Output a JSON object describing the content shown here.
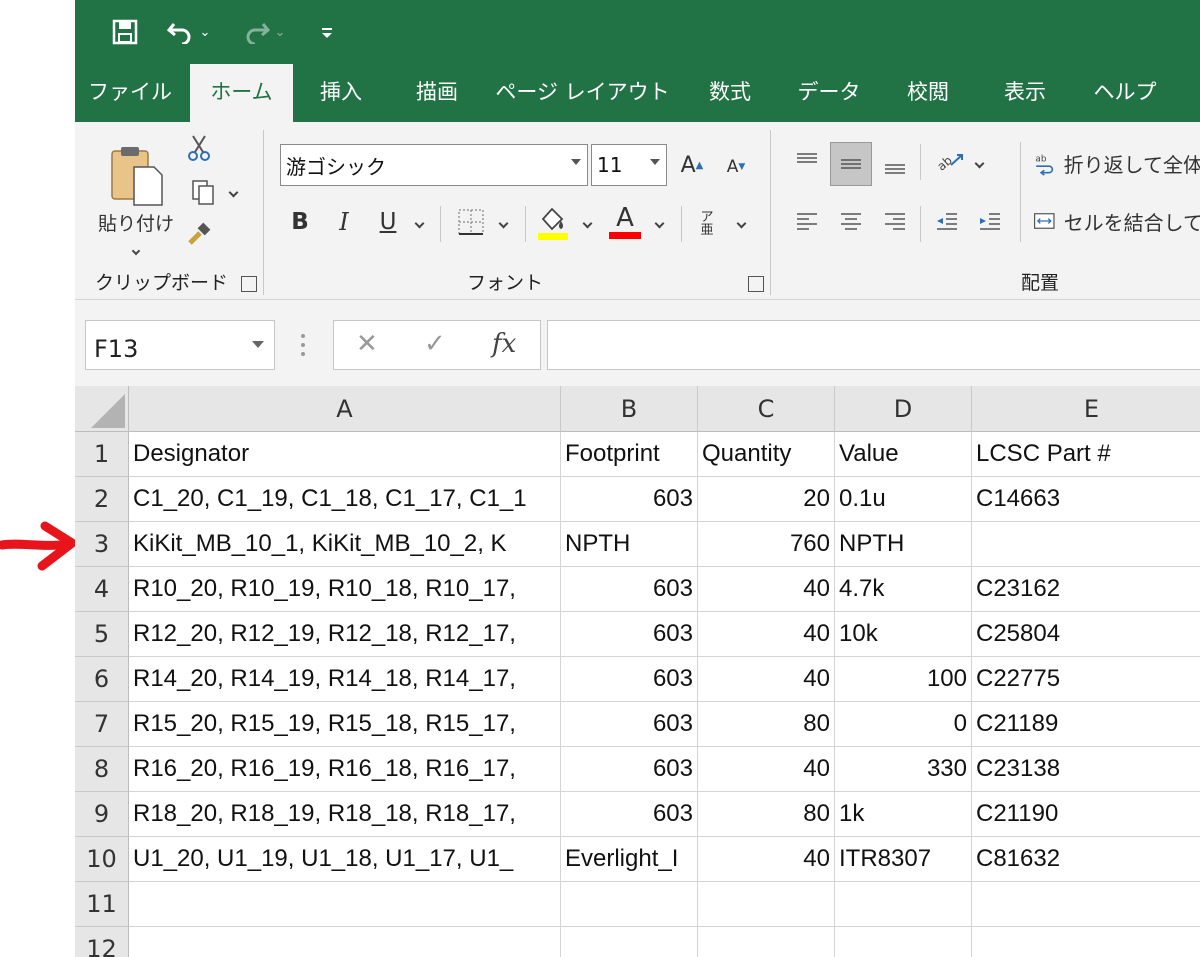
{
  "qat": {
    "save_icon": "save-icon",
    "undo_icon": "undo-icon",
    "redo_icon": "redo-icon",
    "customize_icon": "customize-qat-icon"
  },
  "tabs": [
    "ファイル",
    "ホーム",
    "挿入",
    "描画",
    "ページ レイアウト",
    "数式",
    "データ",
    "校閲",
    "表示",
    "ヘルプ"
  ],
  "active_tab": "ホーム",
  "ribbon": {
    "clipboard": {
      "paste_label": "貼り付け",
      "group_label": "クリップボード"
    },
    "font": {
      "font_name": "游ゴシック",
      "font_size": "11",
      "grow_label": "A",
      "shrink_label": "A",
      "bold": "B",
      "italic": "I",
      "underline": "U",
      "font_color_label": "A",
      "phonetic_label": "ア亜",
      "group_label": "フォント",
      "fill_color": "#ffff00",
      "font_color": "#ff0000"
    },
    "alignment": {
      "wrap_text": "折り返して全体",
      "merge_center": "セルを結合して",
      "group_label": "配置"
    }
  },
  "formula_bar": {
    "name_box": "F13",
    "cancel": "✕",
    "enter": "✓",
    "fx": "fx",
    "value": ""
  },
  "sheet": {
    "columns": [
      "A",
      "B",
      "C",
      "D",
      "E"
    ],
    "rows": [
      {
        "n": "1",
        "cells": [
          "Designator",
          "Footprint",
          "Quantity",
          "Value",
          "LCSC Part #"
        ]
      },
      {
        "n": "2",
        "cells": [
          "C1_20, C1_19, C1_18, C1_17, C1_1",
          "603",
          "20",
          "0.1u",
          "C14663"
        ]
      },
      {
        "n": "3",
        "cells": [
          "KiKit_MB_10_1, KiKit_MB_10_2, K",
          "NPTH",
          "760",
          "NPTH",
          ""
        ]
      },
      {
        "n": "4",
        "cells": [
          "R10_20, R10_19, R10_18, R10_17,",
          "603",
          "40",
          "4.7k",
          "C23162"
        ]
      },
      {
        "n": "5",
        "cells": [
          "R12_20, R12_19, R12_18, R12_17,",
          "603",
          "40",
          "10k",
          "C25804"
        ]
      },
      {
        "n": "6",
        "cells": [
          "R14_20, R14_19, R14_18, R14_17,",
          "603",
          "40",
          "100",
          "C22775"
        ]
      },
      {
        "n": "7",
        "cells": [
          "R15_20, R15_19, R15_18, R15_17,",
          "603",
          "80",
          "0",
          "C21189"
        ]
      },
      {
        "n": "8",
        "cells": [
          "R16_20, R16_19, R16_18, R16_17,",
          "603",
          "40",
          "330",
          "C23138"
        ]
      },
      {
        "n": "9",
        "cells": [
          "R18_20, R18_19, R18_18, R18_17,",
          "603",
          "80",
          "1k",
          "C21190"
        ]
      },
      {
        "n": "10",
        "cells": [
          "U1_20, U1_19, U1_18, U1_17, U1_",
          "Everlight_I",
          "40",
          "ITR8307",
          "C81632"
        ]
      },
      {
        "n": "11",
        "cells": [
          "",
          "",
          "",
          "",
          ""
        ]
      },
      {
        "n": "12",
        "cells": [
          "",
          "",
          "",
          "",
          ""
        ]
      }
    ],
    "numeric_align": [
      [
        false,
        false,
        false,
        false,
        false
      ],
      [
        false,
        true,
        true,
        false,
        false
      ],
      [
        false,
        false,
        true,
        false,
        false
      ],
      [
        false,
        true,
        true,
        false,
        false
      ],
      [
        false,
        true,
        true,
        false,
        false
      ],
      [
        false,
        true,
        true,
        true,
        false
      ],
      [
        false,
        true,
        true,
        true,
        false
      ],
      [
        false,
        true,
        true,
        true,
        false
      ],
      [
        false,
        true,
        true,
        false,
        false
      ],
      [
        false,
        false,
        true,
        false,
        false
      ],
      [
        false,
        false,
        false,
        false,
        false
      ],
      [
        false,
        false,
        false,
        false,
        false
      ]
    ]
  },
  "annotation": {
    "arrow_color": "#e8141b",
    "pointer": "row-3-arrow"
  }
}
